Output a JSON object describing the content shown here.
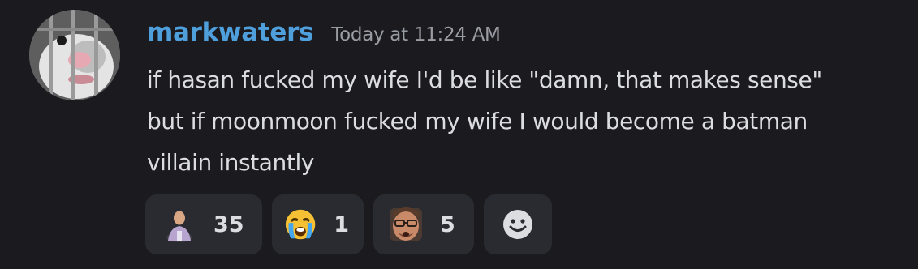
{
  "message": {
    "author": "markwaters",
    "timestamp": "Today at 11:24 AM",
    "lines": [
      "if hasan fucked my wife I'd be like \"damn, that makes sense\"",
      "but if moonmoon fucked my wife I would become a batman",
      "villain instantly"
    ]
  },
  "reactions": [
    {
      "icon": "person-emote-icon",
      "count": "35"
    },
    {
      "icon": "crying-face-icon",
      "count": "1"
    },
    {
      "icon": "face-emote-icon",
      "count": "5"
    }
  ],
  "add_reaction": {
    "icon": "smiley-add-reaction-icon"
  },
  "colors": {
    "background": "#1b1b1f",
    "username": "#4f9fdd",
    "timestamp": "#9a9ca3",
    "text": "#dcdde1",
    "reaction_bg": "#2a2b30"
  }
}
